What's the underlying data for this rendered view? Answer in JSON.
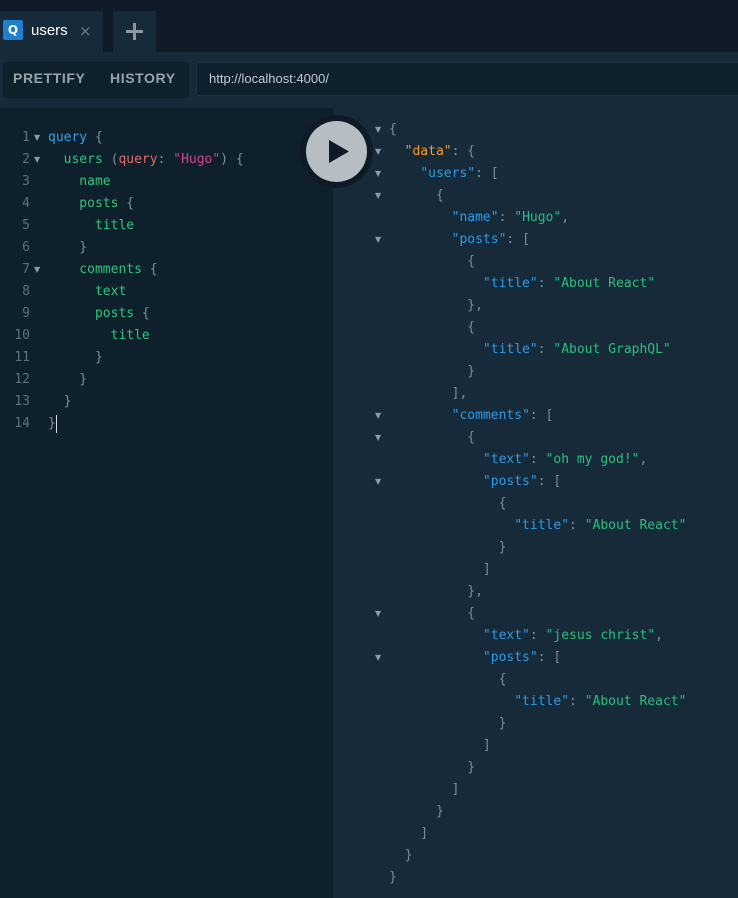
{
  "tab": {
    "badge": "Q",
    "title": "users",
    "close": "×"
  },
  "toolbar": {
    "prettify": "PRETTIFY",
    "history": "HISTORY",
    "url": "http://localhost:4000/"
  },
  "editor": {
    "lines": [
      [
        [
          "kw",
          "query"
        ],
        [
          "punc",
          " {"
        ]
      ],
      [
        [
          "punc",
          "  "
        ],
        [
          "field",
          "users"
        ],
        [
          "punc",
          " ("
        ],
        [
          "arg",
          "query"
        ],
        [
          "punc",
          ": "
        ],
        [
          "str",
          "\"Hugo\""
        ],
        [
          "punc",
          ") {"
        ]
      ],
      [
        [
          "field",
          "    name"
        ]
      ],
      [
        [
          "field",
          "    posts"
        ],
        [
          "punc",
          " {"
        ]
      ],
      [
        [
          "field",
          "      title"
        ]
      ],
      [
        [
          "punc",
          "    }"
        ]
      ],
      [
        [
          "field",
          "    comments"
        ],
        [
          "punc",
          " {"
        ]
      ],
      [
        [
          "field",
          "      text"
        ]
      ],
      [
        [
          "field",
          "      posts"
        ],
        [
          "punc",
          " {"
        ]
      ],
      [
        [
          "field",
          "        title"
        ]
      ],
      [
        [
          "punc",
          "      }"
        ]
      ],
      [
        [
          "punc",
          "    }"
        ]
      ],
      [
        [
          "punc",
          "  }"
        ]
      ],
      [
        [
          "punc",
          "}"
        ]
      ]
    ],
    "folds": [
      1,
      2,
      7
    ]
  },
  "results": {
    "lines": [
      [
        [
          "punc",
          "{"
        ]
      ],
      [
        [
          "punc",
          "  "
        ],
        [
          "data",
          "\"data\""
        ],
        [
          "punc",
          ": {"
        ]
      ],
      [
        [
          "punc",
          "    "
        ],
        [
          "key",
          "\"users\""
        ],
        [
          "punc",
          ": ["
        ]
      ],
      [
        [
          "punc",
          "      {"
        ]
      ],
      [
        [
          "punc",
          "        "
        ],
        [
          "key",
          "\"name\""
        ],
        [
          "punc",
          ": "
        ],
        [
          "val",
          "\"Hugo\""
        ],
        [
          "punc",
          ","
        ]
      ],
      [
        [
          "punc",
          "        "
        ],
        [
          "key",
          "\"posts\""
        ],
        [
          "punc",
          ": ["
        ]
      ],
      [
        [
          "punc",
          "          {"
        ]
      ],
      [
        [
          "punc",
          "            "
        ],
        [
          "key",
          "\"title\""
        ],
        [
          "punc",
          ": "
        ],
        [
          "val",
          "\"About React\""
        ]
      ],
      [
        [
          "punc",
          "          },"
        ]
      ],
      [
        [
          "punc",
          "          {"
        ]
      ],
      [
        [
          "punc",
          "            "
        ],
        [
          "key",
          "\"title\""
        ],
        [
          "punc",
          ": "
        ],
        [
          "val",
          "\"About GraphQL\""
        ]
      ],
      [
        [
          "punc",
          "          }"
        ]
      ],
      [
        [
          "punc",
          "        ],"
        ]
      ],
      [
        [
          "punc",
          "        "
        ],
        [
          "key",
          "\"comments\""
        ],
        [
          "punc",
          ": ["
        ]
      ],
      [
        [
          "punc",
          "          {"
        ]
      ],
      [
        [
          "punc",
          "            "
        ],
        [
          "key",
          "\"text\""
        ],
        [
          "punc",
          ": "
        ],
        [
          "val",
          "\"oh my god!\""
        ],
        [
          "punc",
          ","
        ]
      ],
      [
        [
          "punc",
          "            "
        ],
        [
          "key",
          "\"posts\""
        ],
        [
          "punc",
          ": ["
        ]
      ],
      [
        [
          "punc",
          "              {"
        ]
      ],
      [
        [
          "punc",
          "                "
        ],
        [
          "key",
          "\"title\""
        ],
        [
          "punc",
          ": "
        ],
        [
          "val",
          "\"About React\""
        ]
      ],
      [
        [
          "punc",
          "              }"
        ]
      ],
      [
        [
          "punc",
          "            ]"
        ]
      ],
      [
        [
          "punc",
          "          },"
        ]
      ],
      [
        [
          "punc",
          "          {"
        ]
      ],
      [
        [
          "punc",
          "            "
        ],
        [
          "key",
          "\"text\""
        ],
        [
          "punc",
          ": "
        ],
        [
          "val",
          "\"jesus christ\""
        ],
        [
          "punc",
          ","
        ]
      ],
      [
        [
          "punc",
          "            "
        ],
        [
          "key",
          "\"posts\""
        ],
        [
          "punc",
          ": ["
        ]
      ],
      [
        [
          "punc",
          "              {"
        ]
      ],
      [
        [
          "punc",
          "                "
        ],
        [
          "key",
          "\"title\""
        ],
        [
          "punc",
          ": "
        ],
        [
          "val",
          "\"About React\""
        ]
      ],
      [
        [
          "punc",
          "              }"
        ]
      ],
      [
        [
          "punc",
          "            ]"
        ]
      ],
      [
        [
          "punc",
          "          }"
        ]
      ],
      [
        [
          "punc",
          "        ]"
        ]
      ],
      [
        [
          "punc",
          "      }"
        ]
      ],
      [
        [
          "punc",
          "    ]"
        ]
      ],
      [
        [
          "punc",
          "  }"
        ]
      ],
      [
        [
          "punc",
          "}"
        ]
      ]
    ],
    "folds": [
      1,
      2,
      3,
      4,
      6,
      14,
      15,
      17,
      23,
      25
    ]
  },
  "icons": {
    "run": "play-icon",
    "add_tab": "plus-icon",
    "fold": "triangle-down-icon"
  }
}
